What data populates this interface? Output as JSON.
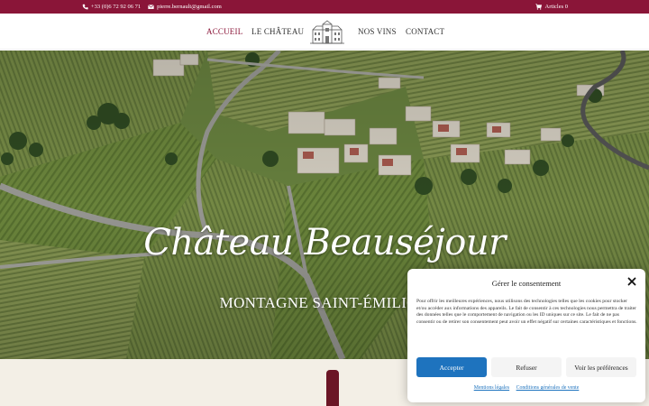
{
  "topbar": {
    "phone": "+33 (0)6 72 92 06 71",
    "email": "pierre.bernault@gmail.com",
    "cart": "Articles 0",
    "background_color": "#8a1538",
    "icons": [
      "phone-icon",
      "mail-icon",
      "cart-icon"
    ]
  },
  "nav": {
    "items": [
      {
        "label": "ACCUEIL",
        "active": true
      },
      {
        "label": "LE CHÂTEAU",
        "active": false
      },
      {
        "label": "NOS VINS",
        "active": false
      },
      {
        "label": "CONTACT",
        "active": false
      }
    ],
    "active_color": "#8a1538",
    "logo_icon": "chateau-logo-icon"
  },
  "hero": {
    "title": "Château Beauséjour",
    "subtitle": "MONTAGNE SAINT-ÉMILION"
  },
  "consent": {
    "title": "Gérer le consentement",
    "description": "Pour offrir les meilleures expériences, nous utilisons des technologies telles que les cookies pour stocker et/ou accéder aux informations des appareils. Le fait de consentir à ces technologies nous permettra de traiter des données telles que le comportement de navigation ou les ID uniques sur ce site. Le fait de ne pas consentir ou de retirer son consentement peut avoir un effet négatif sur certaines caractéristiques et fonctions.",
    "accept_label": "Accepter",
    "refuse_label": "Refuser",
    "prefs_label": "Voir les préférences",
    "link_legal": "Mentions légales",
    "link_terms": "Conditions générales de vente",
    "accent_color": "#1e73be",
    "close_icon": "close-icon"
  }
}
